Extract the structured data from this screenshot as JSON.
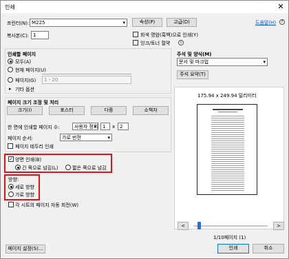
{
  "window": {
    "title": "인쇄",
    "close_icon": "close-icon"
  },
  "printer": {
    "label": "프린터(N):",
    "value": "M225",
    "properties": "속성(P)",
    "advanced": "고급(D)",
    "help": "도움말(H)"
  },
  "copies": {
    "label": "복사본(C):",
    "value": "1"
  },
  "options": {
    "grayscale": "회색 명암(흑백)으로 인쇄(Y)",
    "save_ink": "잉크/토너 절약"
  },
  "pages_to_print": {
    "heading": "인쇄할 페이지",
    "all": "모두(A)",
    "current": "현재 페이지(U)",
    "pages": "페이지(G)",
    "pages_value": "1 - 20",
    "more": "기타 옵션"
  },
  "sizing": {
    "heading": "페이지 크기 조정 및 처리",
    "buttons": [
      "크기(I)",
      "포스터",
      "다중",
      "소책자"
    ],
    "per_sheet_label": "한 면에 인쇄할 페이지 수:",
    "per_sheet_value": "사용자 정의...",
    "cols": "1",
    "x": "x",
    "rows": "2",
    "order_label": "페이지 순서:",
    "order_value": "가로 반전",
    "border": "페이지 테두리 인쇄"
  },
  "duplex": {
    "label": "양면 인쇄(B)",
    "long_edge": "긴 쪽으로 넘김(L)",
    "short_edge": "짧은 쪽으로 넘김"
  },
  "orientation": {
    "heading": "방향:",
    "portrait": "세로 방향",
    "landscape": "가로 방향"
  },
  "auto_rotate": "각 시트의 페이지 자동 회전(W)",
  "comments": {
    "heading": "주석 및 양식(M)",
    "value": "문서 및 마크업",
    "summary": "주석 요약(T)"
  },
  "preview": {
    "size": "175.94 x 249.94 밀리미터",
    "page_label": "1/10페이지 (1)",
    "prev": "<",
    "next": ">",
    "progress": 0.0
  },
  "footer": {
    "page_setup": "페이지 설정(S)...",
    "print": "인쇄",
    "cancel": "취소"
  },
  "colors": {
    "highlight": "#e0131b",
    "link": "#0b57d0",
    "slider": "#1a73e8"
  }
}
